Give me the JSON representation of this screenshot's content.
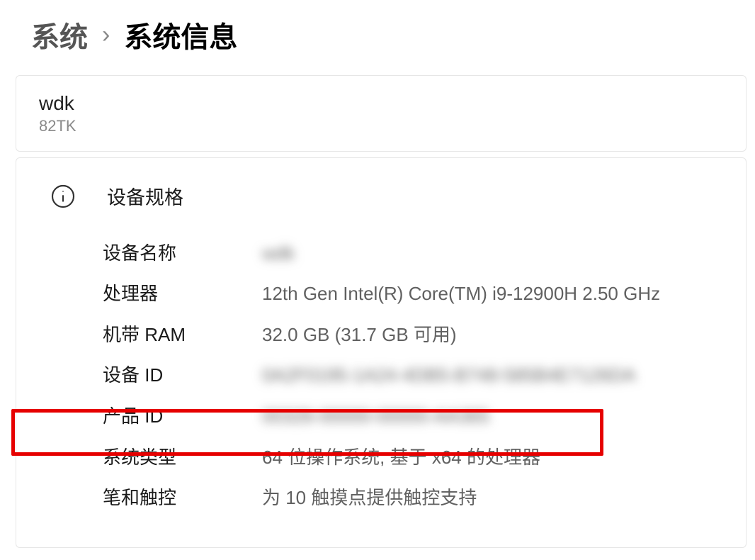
{
  "breadcrumb": {
    "parent": "系统",
    "separator": "›",
    "current": "系统信息"
  },
  "device_card": {
    "name": "wdk",
    "model": "82TK"
  },
  "specs": {
    "section_title": "设备规格",
    "device_name_label": "设备名称",
    "device_name_value": "wdk",
    "processor_label": "处理器",
    "processor_value": "12th Gen Intel(R) Core(TM) i9-12900H   2.50 GHz",
    "ram_label": "机带 RAM",
    "ram_value": "32.0 GB (31.7 GB 可用)",
    "device_id_label": "设备 ID",
    "device_id_value": "0A2F0195-1A24-4DB5-B748-585B4E7126DA",
    "product_id_label": "产品 ID",
    "product_id_value": "00326-00000-00000-AA365",
    "system_type_label": "系统类型",
    "system_type_value": "64 位操作系统, 基于 x64 的处理器",
    "pen_touch_label": "笔和触控",
    "pen_touch_value": "为 10 触摸点提供触控支持"
  }
}
